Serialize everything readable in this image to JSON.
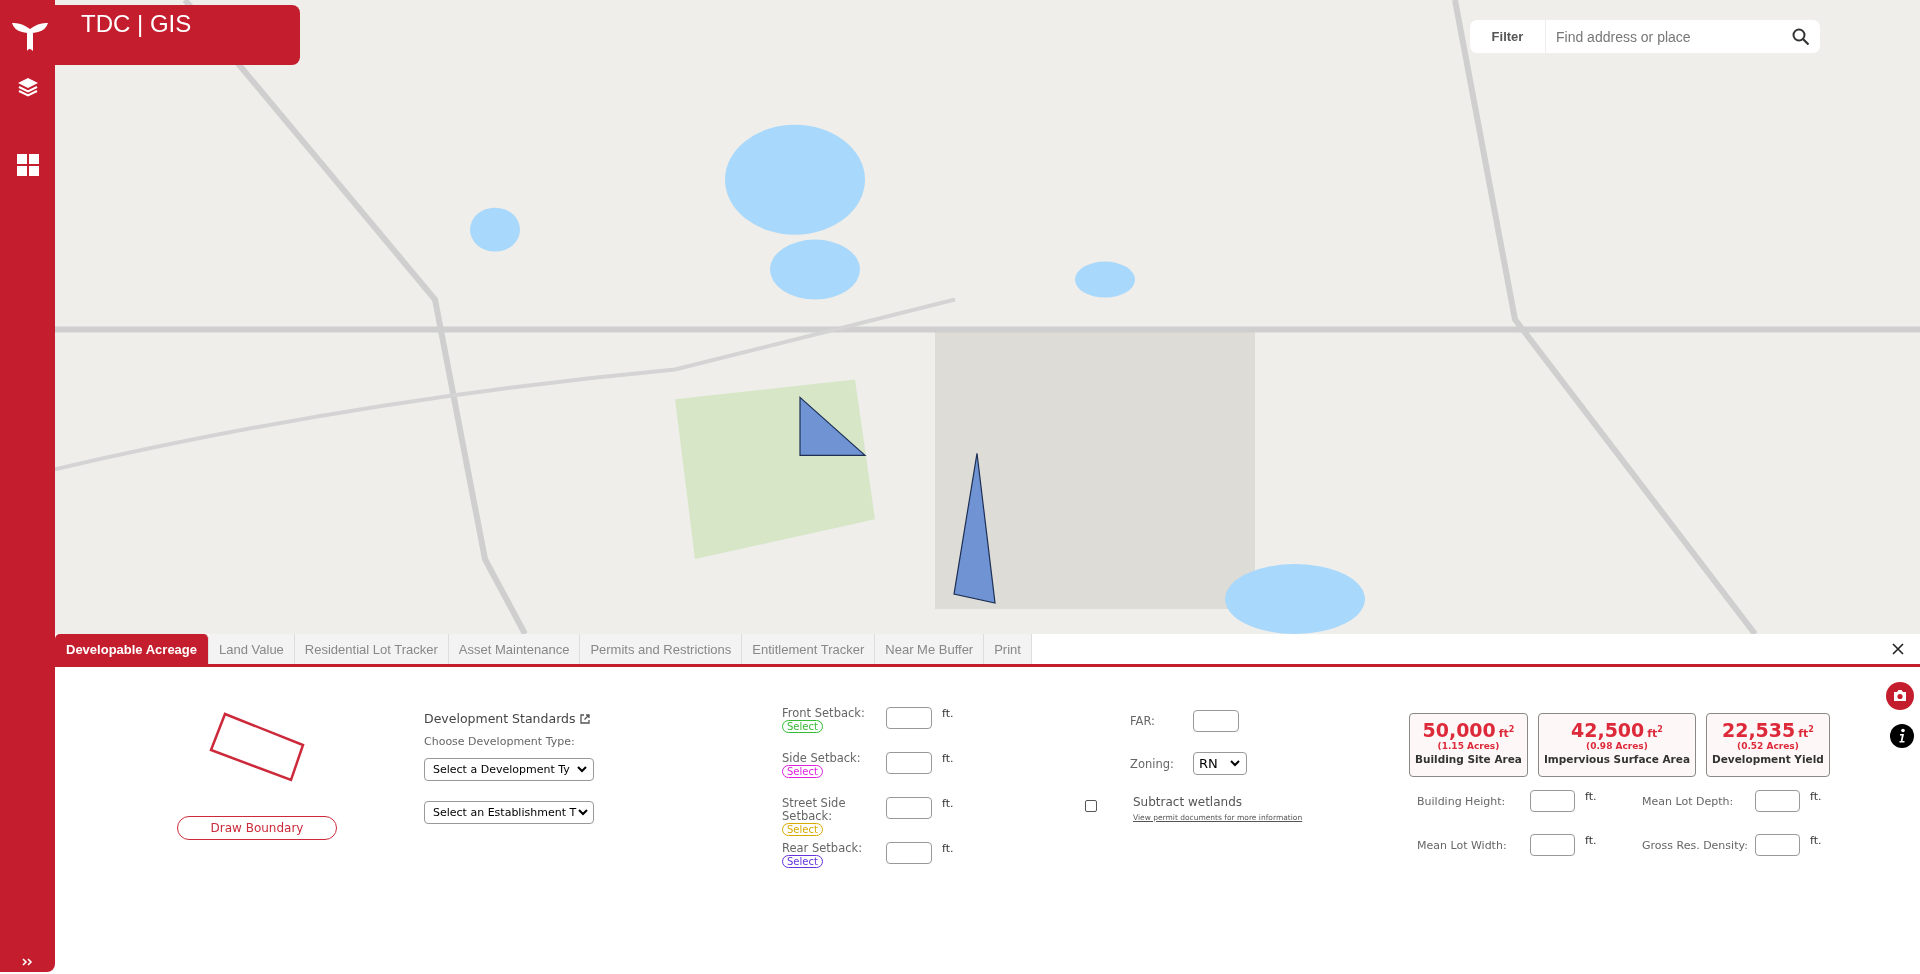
{
  "header": {
    "title": "TDC | GIS"
  },
  "search": {
    "filter_label": "Filter",
    "placeholder": "Find address or place"
  },
  "tabs": [
    {
      "label": "Developable Acreage",
      "selected": true
    },
    {
      "label": "Land Value",
      "selected": false
    },
    {
      "label": "Residential Lot Tracker",
      "selected": false
    },
    {
      "label": "Asset Maintenance",
      "selected": false
    },
    {
      "label": "Permits and Restrictions",
      "selected": false
    },
    {
      "label": "Entitlement Tracker",
      "selected": false
    },
    {
      "label": "Near Me Buffer",
      "selected": false
    },
    {
      "label": "Print",
      "selected": false
    }
  ],
  "panel": {
    "draw_button": "Draw Boundary",
    "standards": {
      "title": "Development Standards",
      "prompt": "Choose Development Type:",
      "selects": [
        "Select a Development Ty",
        "Select an Establishment T"
      ]
    },
    "setbacks": [
      {
        "label": "Front Setback:",
        "unit": "ft.",
        "pick": "Select",
        "color": "#33bb33"
      },
      {
        "label": "Side Setback:",
        "unit": "ft.",
        "pick": "Select",
        "color": "#dd22dd"
      },
      {
        "label": "Street Side Setback:",
        "unit": "ft.",
        "pick": "Select",
        "color": "#d8aa00"
      },
      {
        "label": "Rear Setback:",
        "unit": "ft.",
        "pick": "Select",
        "color": "#6633dd"
      }
    ],
    "far": {
      "label": "FAR:"
    },
    "zoning": {
      "label": "Zoning:",
      "value": "RN"
    },
    "wetlands": {
      "label": "Subtract wetlands",
      "checked": false,
      "link": "View permit documents for more information"
    },
    "results": [
      {
        "value": "50,000",
        "unit": "ft$^{2}$",
        "acres": "(1.15 Acres)",
        "label": "Building Site Area"
      },
      {
        "value": "42,500",
        "unit": "ft$^{2}$",
        "acres": "(0.98 Acres)",
        "label": "Impervious Surface Area"
      },
      {
        "value": "22,535",
        "unit": "ft$^{2}$",
        "acres": "(0.52 Acres)",
        "label": "Development Yield"
      }
    ],
    "measures": [
      {
        "label": "Building Height:",
        "unit": "ft."
      },
      {
        "label": "Mean Lot Depth:",
        "unit": "ft."
      },
      {
        "label": "Mean Lot Width:",
        "unit": "ft."
      },
      {
        "label": "Gross Res. Density:",
        "unit": "ft."
      }
    ]
  }
}
